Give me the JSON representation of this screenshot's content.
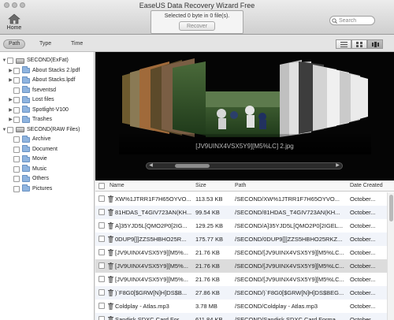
{
  "window": {
    "title": "EaseUS Data Recovery Wizard Free"
  },
  "toolbar": {
    "home_label": "Home",
    "status_text": "Selected 0 byte in 0 file(s).",
    "recover_label": "Recover",
    "search_placeholder": "Search"
  },
  "tabs": [
    {
      "label": "Path",
      "active": true
    },
    {
      "label": "Type",
      "active": false
    },
    {
      "label": "Time",
      "active": false
    }
  ],
  "view_modes": [
    "list-view-icon",
    "grid-view-icon",
    "coverflow-view-icon"
  ],
  "tree": [
    {
      "label": "SECOND(ExFat)",
      "kind": "drive",
      "expanded": true,
      "level": 0
    },
    {
      "label": "About Stacks 2.lpdf",
      "kind": "folder",
      "expandable": true,
      "level": 1
    },
    {
      "label": "About Stacks.lpdf",
      "kind": "folder",
      "expandable": true,
      "level": 1
    },
    {
      "label": "fseventsd",
      "kind": "folder",
      "expandable": false,
      "level": 1
    },
    {
      "label": "Lost files",
      "kind": "folder",
      "expandable": true,
      "level": 1
    },
    {
      "label": "Spotlight-V100",
      "kind": "folder",
      "expandable": true,
      "level": 1
    },
    {
      "label": "Trashes",
      "kind": "folder",
      "expandable": true,
      "level": 1
    },
    {
      "label": "SECOND(RAW Files)",
      "kind": "drive",
      "expanded": true,
      "level": 0
    },
    {
      "label": "Archive",
      "kind": "folder",
      "expandable": false,
      "level": 1
    },
    {
      "label": "Document",
      "kind": "folder",
      "expandable": false,
      "level": 1
    },
    {
      "label": "Movie",
      "kind": "folder",
      "expandable": false,
      "level": 1
    },
    {
      "label": "Music",
      "kind": "folder",
      "expandable": false,
      "level": 1
    },
    {
      "label": "Others",
      "kind": "folder",
      "expandable": false,
      "level": 1
    },
    {
      "label": "Pictures",
      "kind": "folder",
      "expandable": false,
      "level": 1
    }
  ],
  "preview": {
    "caption": "[JV9UINX4VSX5Y9][M5%LC] 2.jpg"
  },
  "columns": {
    "name": "Name",
    "size": "Size",
    "path": "Path",
    "date": "Date Created"
  },
  "files": [
    {
      "name": "XW%1JTRR1F7H65OYVO...",
      "size": "113.53 KB",
      "path": "/SECOND/XW%1JTRR1F7H65OYVO...",
      "date": "October..."
    },
    {
      "name": "81HDAS_T4GIV723AN(KH...",
      "size": "99.54 KB",
      "path": "/SECOND/81HDAS_T4GIV723AN(KH...",
      "date": "October..."
    },
    {
      "name": "A]35YJD5L[QMO2P0[2IG...",
      "size": "129.25 KB",
      "path": "/SECOND/A]35YJD5L[QMO2P0[2IGEL...",
      "date": "October..."
    },
    {
      "name": "0DUP9[]]ZZS5HBHO25R...",
      "size": "175.77 KB",
      "path": "/SECOND/0DUP9[]]ZZS5HBHO25RKZ...",
      "date": "October..."
    },
    {
      "name": "[JV9UINX4VSX5Y9][M5%...",
      "size": "21.76 KB",
      "path": "/SECOND/[JV9UINX4VSX5Y9][M5%LC...",
      "date": "October..."
    },
    {
      "name": "[JV9UINX4VSX5Y9][M5%...",
      "size": "21.76 KB",
      "path": "/SECOND/[JV9UINX4VSX5Y9][M5%LC...",
      "date": "October...",
      "selected": true
    },
    {
      "name": "[JV9UINX4VSX5Y9][M5%...",
      "size": "21.76 KB",
      "path": "/SECOND/[JV9UINX4VSX5Y9][M5%LC...",
      "date": "October..."
    },
    {
      "name": ")`F8G0[$GRW[N]H]DS$B...",
      "size": "27.86 KB",
      "path": "/SECOND/)`F8G0[$GRW[N]H]DS$BEG...",
      "date": "October..."
    },
    {
      "name": "Coldplay - Atlas.mp3",
      "size": "3.78 MB",
      "path": "/SECOND/Coldplay - Atlas.mp3",
      "date": "October..."
    },
    {
      "name": "Sandisk SDXC Card For...",
      "size": "611.84 KB",
      "path": "/SECOND/Sandisk SDXC Card Forma...",
      "date": "October..."
    }
  ]
}
